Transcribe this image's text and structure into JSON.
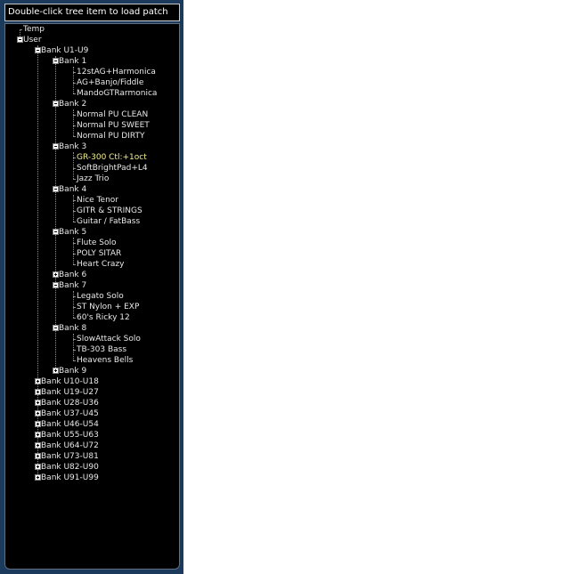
{
  "header": {
    "instruction": "Double-click tree item to load patch"
  },
  "tree": [
    {
      "label": "Temp",
      "level": 0,
      "leaf": true
    },
    {
      "label": "User",
      "level": 0,
      "expanded": true
    },
    {
      "label": "Bank U1-U9",
      "level": 1,
      "expanded": true
    },
    {
      "label": "Bank 1",
      "level": 2,
      "expanded": true
    },
    {
      "label": "12stAG+Harmonica",
      "level": 3,
      "leaf": true
    },
    {
      "label": "AG+Banjo/Fiddle",
      "level": 3,
      "leaf": true
    },
    {
      "label": "MandoGTRarmonica",
      "level": 3,
      "leaf": true
    },
    {
      "label": "Bank 2",
      "level": 2,
      "expanded": true
    },
    {
      "label": "Normal PU CLEAN",
      "level": 3,
      "leaf": true
    },
    {
      "label": "Normal PU SWEET",
      "level": 3,
      "leaf": true
    },
    {
      "label": "Normal PU DIRTY",
      "level": 3,
      "leaf": true
    },
    {
      "label": "Bank 3",
      "level": 2,
      "expanded": true
    },
    {
      "label": "GR-300 Ctl:+1oct",
      "level": 3,
      "leaf": true,
      "highlight": true
    },
    {
      "label": "SoftBrightPad+L4",
      "level": 3,
      "leaf": true
    },
    {
      "label": "Jazz Trio",
      "level": 3,
      "leaf": true
    },
    {
      "label": "Bank 4",
      "level": 2,
      "expanded": true
    },
    {
      "label": "Nice Tenor",
      "level": 3,
      "leaf": true
    },
    {
      "label": "GITR & STRINGS",
      "level": 3,
      "leaf": true
    },
    {
      "label": "Guitar / FatBass",
      "level": 3,
      "leaf": true
    },
    {
      "label": "Bank 5",
      "level": 2,
      "expanded": true
    },
    {
      "label": "Flute Solo",
      "level": 3,
      "leaf": true
    },
    {
      "label": "POLY SITAR",
      "level": 3,
      "leaf": true
    },
    {
      "label": "Heart Crazy",
      "level": 3,
      "leaf": true
    },
    {
      "label": "Bank 6",
      "level": 2,
      "expanded": false
    },
    {
      "label": "Bank 7",
      "level": 2,
      "expanded": true
    },
    {
      "label": "Legato Solo",
      "level": 3,
      "leaf": true
    },
    {
      "label": "ST Nylon + EXP",
      "level": 3,
      "leaf": true
    },
    {
      "label": "60's Ricky 12",
      "level": 3,
      "leaf": true
    },
    {
      "label": "Bank 8",
      "level": 2,
      "expanded": true
    },
    {
      "label": "SlowAttack Solo",
      "level": 3,
      "leaf": true
    },
    {
      "label": "TB-303 Bass",
      "level": 3,
      "leaf": true
    },
    {
      "label": "Heavens Bells",
      "level": 3,
      "leaf": true
    },
    {
      "label": "Bank 9",
      "level": 2,
      "expanded": false
    },
    {
      "label": "Bank U10-U18",
      "level": 1,
      "expanded": false
    },
    {
      "label": "Bank U19-U27",
      "level": 1,
      "expanded": false
    },
    {
      "label": "Bank U28-U36",
      "level": 1,
      "expanded": false
    },
    {
      "label": "Bank U37-U45",
      "level": 1,
      "expanded": false
    },
    {
      "label": "Bank U46-U54",
      "level": 1,
      "expanded": false
    },
    {
      "label": "Bank U55-U63",
      "level": 1,
      "expanded": false
    },
    {
      "label": "Bank U64-U72",
      "level": 1,
      "expanded": false
    },
    {
      "label": "Bank U73-U81",
      "level": 1,
      "expanded": false
    },
    {
      "label": "Bank U82-U90",
      "level": 1,
      "expanded": false
    },
    {
      "label": "Bank U91-U99",
      "level": 1,
      "expanded": false
    }
  ],
  "colors": {
    "panel": "#1c3a5c",
    "tree_background": "#000000",
    "text": "#e8e8e8",
    "highlight_text": "#f4f08c"
  }
}
